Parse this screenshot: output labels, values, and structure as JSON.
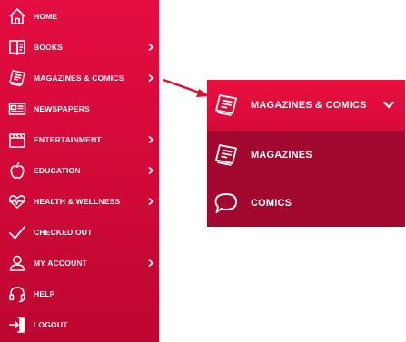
{
  "sidebar": {
    "items": [
      {
        "label": "HOME",
        "icon": "home-icon",
        "has_submenu": false
      },
      {
        "label": "BOOKS",
        "icon": "book-icon",
        "has_submenu": true
      },
      {
        "label": "MAGAZINES & COMICS",
        "icon": "magazine-icon",
        "has_submenu": true
      },
      {
        "label": "NEWSPAPERS",
        "icon": "newspaper-icon",
        "has_submenu": false
      },
      {
        "label": "ENTERTAINMENT",
        "icon": "clapperboard-icon",
        "has_submenu": true
      },
      {
        "label": "EDUCATION",
        "icon": "apple-icon",
        "has_submenu": true
      },
      {
        "label": "HEALTH & WELLNESS",
        "icon": "heartbeat-icon",
        "has_submenu": true
      },
      {
        "label": "CHECKED OUT",
        "icon": "checkmark-icon",
        "has_submenu": false
      },
      {
        "label": "MY ACCOUNT",
        "icon": "user-icon",
        "has_submenu": true
      },
      {
        "label": "HELP",
        "icon": "headset-icon",
        "has_submenu": false
      },
      {
        "label": "LOGOUT",
        "icon": "logout-icon",
        "has_submenu": false
      }
    ]
  },
  "submenu": {
    "header": {
      "label": "MAGAZINES & COMICS",
      "icon": "magazine-icon",
      "chevron": "chevron-down-icon"
    },
    "items": [
      {
        "label": "MAGAZINES",
        "icon": "magazine-icon"
      },
      {
        "label": "COMICS",
        "icon": "speech-bubble-icon"
      }
    ]
  },
  "colors": {
    "sidebar_top": "#e50d41",
    "sidebar_bottom": "#bd0630",
    "submenu_header": "#e8103f",
    "submenu_item_bg": "#a2072f",
    "callout_arrow": "#e0102a",
    "text": "#ffffff"
  }
}
